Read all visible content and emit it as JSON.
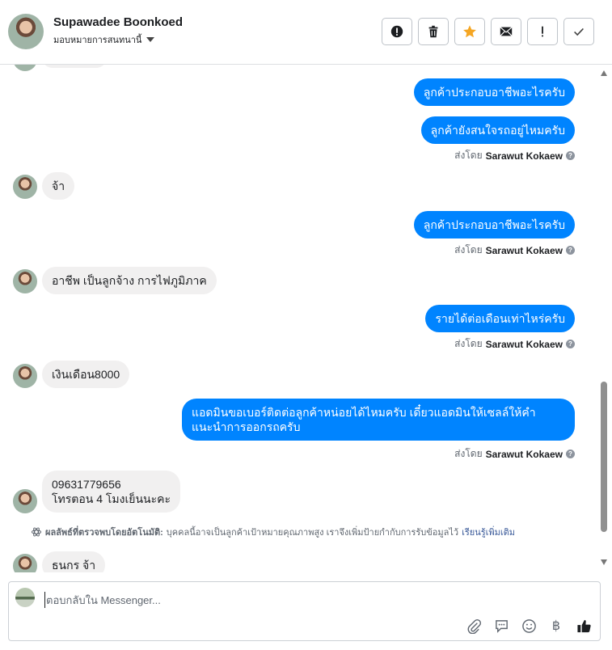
{
  "header": {
    "name": "Supawadee Boonkoed",
    "assign_label": "มอบหมายการสนทนานี้",
    "actions": [
      {
        "name": "spam-alert-icon"
      },
      {
        "name": "trash-icon"
      },
      {
        "name": "star-icon"
      },
      {
        "name": "mail-icon"
      },
      {
        "name": "exclamation-icon"
      },
      {
        "name": "check-icon"
      }
    ]
  },
  "colors": {
    "accent": "#0084ff",
    "star": "#f5a623",
    "bubble_in": "#f1f0f0"
  },
  "messages": [
    {
      "dir": "out",
      "text": "ลูกค้าประกอบอาชีพอะไรครับ"
    },
    {
      "dir": "out",
      "text": "ลูกค้ายังสนใจรถอยู่ไหมครับ"
    },
    {
      "dir": "in",
      "text": "จ้า"
    },
    {
      "dir": "out",
      "text": "ลูกค้าประกอบอาชีพอะไรครับ"
    },
    {
      "dir": "in",
      "text": "อาชีพ  เป็นลูกจ้าง การไฟภูมิภาค"
    },
    {
      "dir": "out",
      "text": "รายได้ต่อเดือนเท่าไหร่ครับ"
    },
    {
      "dir": "in",
      "text": "เงินเดือน8000"
    },
    {
      "dir": "out",
      "text": "แอดมินขอเบอร์ติดต่อลูกค้าหน่อยได้ไหมครับ เดี๋ยวแอดมินให้เซลล์ให้คำแนะนำการออกรถครับ"
    },
    {
      "dir": "in",
      "text": "09631779656\nโทรตอน 4 โมงเย็นนะคะ"
    },
    {
      "dir": "in",
      "text": "ธนกร  จ้า"
    }
  ],
  "sent_by": {
    "prefix": "ส่งโดย",
    "name": "Sarawut Kokaew",
    "help_glyph": "?"
  },
  "auto_note": {
    "title": "ผลลัพธ์ที่ตรวจพบโดยอัตโนมัติ:",
    "body": "บุคคลนี้อาจเป็นลูกค้าเป้าหมายคุณภาพสูง เราจึงเพิ่มป้ายกำกับการรับข้อมูลไว้",
    "link": "เรียนรู้เพิ่มเติม"
  },
  "composer": {
    "placeholder": "ตอบกลับใน Messenger...",
    "tools": [
      "attachment-icon",
      "saved-reply-icon",
      "emoji-icon",
      "baht-icon",
      "thumbs-up-icon"
    ],
    "baht_glyph": "฿"
  }
}
